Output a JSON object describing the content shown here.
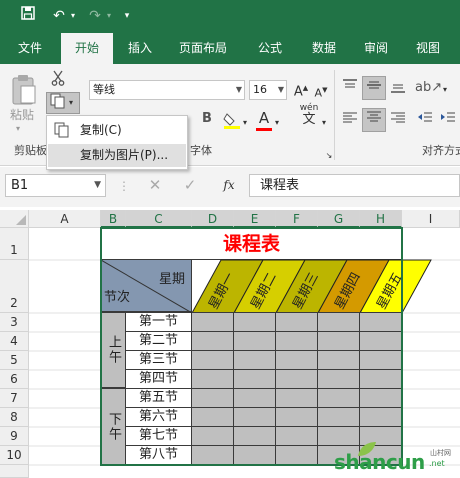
{
  "ribbon_tabs": [
    {
      "label": "文件"
    },
    {
      "label": "开始"
    },
    {
      "label": "插入"
    },
    {
      "label": "页面布局"
    },
    {
      "label": "公式"
    },
    {
      "label": "数据"
    },
    {
      "label": "审阅"
    },
    {
      "label": "视图"
    }
  ],
  "active_tab": "开始",
  "clipboard": {
    "paste_label": "粘贴",
    "group_label": "剪贴板"
  },
  "font": {
    "name": "等线",
    "size": "16",
    "group_label": "字体",
    "phonetic": "wén"
  },
  "alignment": {
    "group_label": "对齐方式"
  },
  "copy_menu": [
    {
      "label": "复制(C)"
    },
    {
      "label": "复制为图片(P)..."
    }
  ],
  "formula_bar": {
    "name_box": "B1",
    "content": "课程表"
  },
  "columns": [
    "A",
    "B",
    "C",
    "D",
    "E",
    "F",
    "G",
    "H",
    "I"
  ],
  "rows": [
    "1",
    "2",
    "3",
    "4",
    "5",
    "6",
    "7",
    "8",
    "9",
    "10"
  ],
  "table": {
    "title": "课程表",
    "corner_top": "星期",
    "corner_bottom": "节次",
    "days": [
      "星期一",
      "星期二",
      "星期三",
      "星期四",
      "星期五"
    ],
    "morning": "上午",
    "afternoon": "下午",
    "lessons": [
      "第一节",
      "第二节",
      "第三节",
      "第四节",
      "第五节",
      "第六节",
      "第七节",
      "第八节"
    ]
  },
  "watermark": {
    "main": "shancun",
    "suffix": ".net",
    "cn": "山村网"
  },
  "colors": {
    "excel_green": "#217346",
    "title_red": "#ff0000",
    "header_blue": "#8497b0",
    "day_fills": [
      "#bcb500",
      "#d6cf00",
      "#bcb500",
      "#d49a00",
      "#ffff00"
    ],
    "cell_gray": "#bfbfbf"
  },
  "icons": {
    "save": "save-icon",
    "undo": "undo-icon",
    "redo": "redo-icon",
    "paste": "paste-icon",
    "cut": "scissors-icon",
    "copy": "copy-icon",
    "fx": "function-icon"
  }
}
